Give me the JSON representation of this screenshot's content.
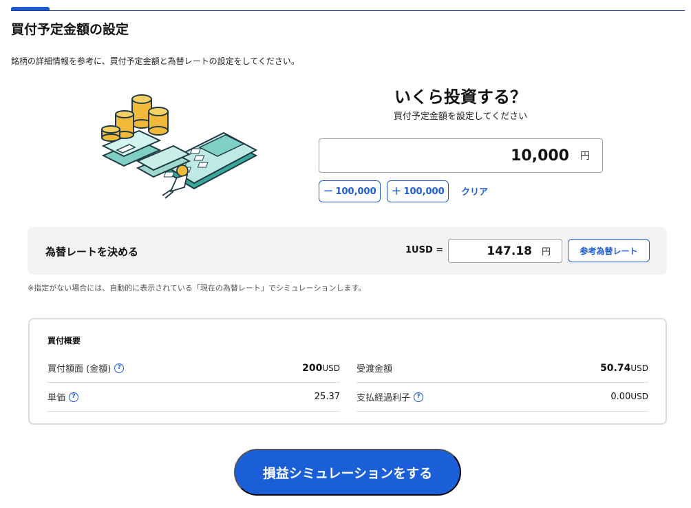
{
  "page": {
    "title": "買付予定金額の設定",
    "intro": "銘柄の詳細情報を参考に、買付予定金額と為替レートの設定をしてください。"
  },
  "amount": {
    "heading": "いくら投資する？",
    "subheading": "買付予定金額を設定してください",
    "value": "10,000",
    "unit": "円",
    "minus_button": "100,000",
    "plus_button": "100,000",
    "clear_label": "クリア"
  },
  "fx": {
    "title": "為替レートを決める",
    "base_label": "1USD =",
    "value": "147.18",
    "unit": "円",
    "reference_button": "参考為替レート",
    "note": "※指定がない場合には、自動的に表示されている「現在の為替レート」でシミュレーションします。"
  },
  "summary": {
    "title": "買付概要",
    "rows": [
      {
        "label": "買付額面 (金額)",
        "value": "200",
        "unit": "USD",
        "help": true
      },
      {
        "label": "単価",
        "value": "25.37",
        "unit": "",
        "help": true
      },
      {
        "label": "受渡金額",
        "value": "50.74",
        "unit": "USD",
        "help": false
      },
      {
        "label": "支払経過利子",
        "value": "0.00",
        "unit": "USD",
        "help": true
      }
    ]
  },
  "cta": {
    "label": "損益シミュレーションをする"
  },
  "colors": {
    "accent": "#1d5cd6",
    "cta": "#1a5fd8",
    "panel": "#f1f3f5"
  },
  "icons": {
    "help": "question-circle-icon",
    "minus": "minus-icon",
    "plus": "plus-icon",
    "illustration": "coins-money-calculator-illustration"
  }
}
